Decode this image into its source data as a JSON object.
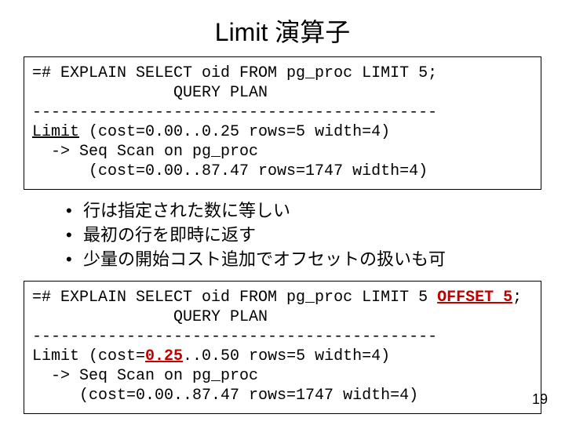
{
  "title": "Limit 演算子",
  "code1": {
    "l1": "=# EXPLAIN SELECT oid FROM pg_proc LIMIT 5;",
    "l2": "               QUERY PLAN",
    "l3": "-------------------------------------------",
    "l4a": "Limit",
    "l4b": " (cost=0.00..0.25 rows=5 width=4)",
    "l5": "  -> Seq Scan on pg_proc",
    "l6": "      (cost=0.00..87.47 rows=1747 width=4)"
  },
  "bullets": [
    "行は指定された数に等しい",
    "最初の行を即時に返す",
    "少量の開始コスト追加でオフセットの扱いも可"
  ],
  "code2": {
    "l1a": "=# EXPLAIN SELECT oid FROM pg_proc LIMIT 5 ",
    "l1b": "OFFSET 5",
    "l1c": ";",
    "l2": "               QUERY PLAN",
    "l3": "-------------------------------------------",
    "l4a": "Limit (cost=",
    "l4b": "0.25",
    "l4c": "..0.50 rows=5 width=4)",
    "l5": "  -> Seq Scan on pg_proc",
    "l6": "     (cost=0.00..87.47 rows=1747 width=4)"
  },
  "page_number": "19"
}
